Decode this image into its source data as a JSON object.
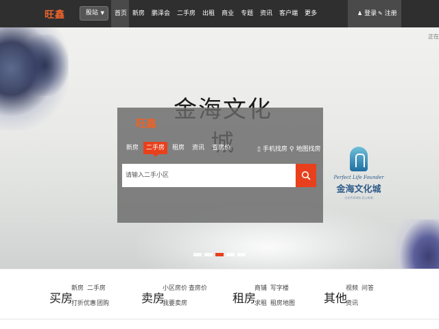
{
  "topbar": {
    "logo": "旺鑫",
    "city": "股站",
    "nav": [
      "首页",
      "新房",
      "鹏泽会",
      "二手房",
      "出租",
      "商业",
      "专题",
      "资讯",
      "客户端",
      "更多"
    ],
    "login": "登录",
    "register": "注册"
  },
  "banner": {
    "title": "金海文化城",
    "corner_tag": "正在",
    "brand_en": "Perfect Life Founder",
    "brand_cn": "金海文化城",
    "brand_sub": "文化传承地标 匠心筑城",
    "carousel_active": 3,
    "carousel_count": 5
  },
  "search": {
    "logo": "旺鑫",
    "tabs": [
      "新房",
      "二手房",
      "租房",
      "资讯",
      "查房价"
    ],
    "active_tab": "二手房",
    "mobile_link": "手机找房",
    "map_link": "地图找房",
    "placeholder": "请输入二手小区"
  },
  "categories": [
    {
      "title": "买房",
      "links": [
        "新房",
        "二手房",
        "打折优惠",
        "团购"
      ]
    },
    {
      "title": "卖房",
      "links": [
        "小区房价",
        "查房价",
        "我要卖房"
      ]
    },
    {
      "title": "租房",
      "links": [
        "商铺",
        "写字楼",
        "求租",
        "租房地图"
      ]
    },
    {
      "title": "其他",
      "links": [
        "视频",
        "问答",
        "资讯"
      ]
    }
  ],
  "colors": {
    "accent": "#e8401c",
    "topbar": "#2f2f2f",
    "logo": "#e8632b"
  }
}
